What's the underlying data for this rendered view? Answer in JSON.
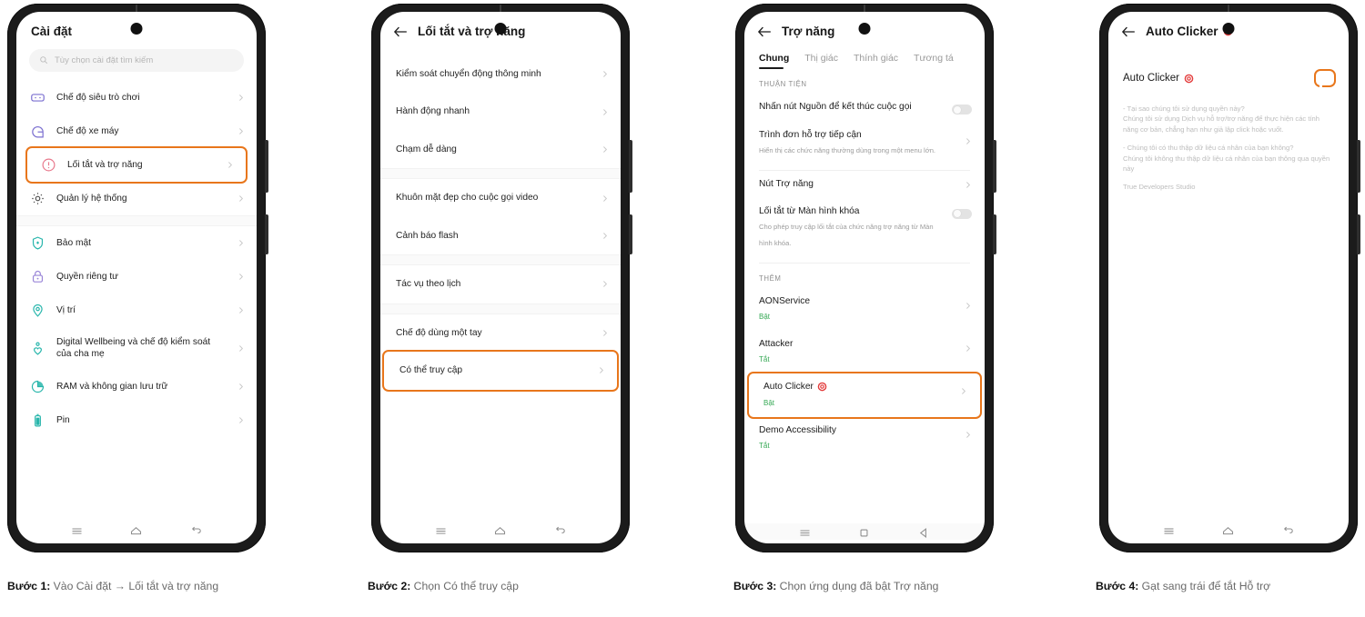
{
  "phones": [
    {
      "id": "settings",
      "header_title": "Cài đặt",
      "search_placeholder": "Tùy chọn cài đặt tìm kiếm",
      "items": [
        {
          "label": "Chế độ siêu trò chơi",
          "icon": "game-controller-icon",
          "highlight": false
        },
        {
          "label": "Chế độ xe máy",
          "icon": "helmet-icon",
          "highlight": false
        },
        {
          "label": "Lối tắt và trợ năng",
          "icon": "accessibility-icon",
          "highlight": true
        },
        {
          "label": "Quản lý hệ thống",
          "icon": "gear-icon",
          "highlight": false
        },
        {
          "label": "Bảo mật",
          "icon": "shield-icon",
          "highlight": false
        },
        {
          "label": "Quyền riêng tư",
          "icon": "lock-icon",
          "highlight": false
        },
        {
          "label": "Vị trí",
          "icon": "location-pin-icon",
          "highlight": false
        },
        {
          "label": "Digital Wellbeing và chế độ kiểm soát của cha mẹ",
          "icon": "wellbeing-icon",
          "highlight": false
        },
        {
          "label": "RAM và không gian lưu trữ",
          "icon": "storage-pie-icon",
          "highlight": false
        },
        {
          "label": "Pin",
          "icon": "battery-icon",
          "highlight": false
        }
      ],
      "navbar": [
        "menu-icon",
        "home-icon",
        "back-icon"
      ]
    },
    {
      "id": "shortcuts",
      "header_title": "Lối tắt và trợ năng",
      "items": [
        {
          "label": "Kiểm soát chuyển động thông minh",
          "highlight": false
        },
        {
          "label": "Hành động nhanh",
          "highlight": false
        },
        {
          "label": "Chạm dễ dàng",
          "highlight": false
        },
        {
          "label": "Khuôn mặt đẹp cho cuộc gọi video",
          "highlight": false
        },
        {
          "label": "Cảnh báo flash",
          "highlight": false
        },
        {
          "label": "Tác vụ theo lịch",
          "highlight": false
        },
        {
          "label": "Chế độ dùng một tay",
          "highlight": false
        },
        {
          "label": "Có thể truy cập",
          "highlight": true
        }
      ],
      "navbar": [
        "menu-icon",
        "home-icon",
        "back-icon"
      ]
    },
    {
      "id": "accessibility",
      "header_title": "Trợ năng",
      "tabs": [
        {
          "label": "Chung",
          "active": true
        },
        {
          "label": "Thị giác",
          "active": false
        },
        {
          "label": "Thính giác",
          "active": false
        },
        {
          "label": "Tương tá",
          "active": false
        }
      ],
      "section1_header": "THUẬN TIỆN",
      "section1_items": [
        {
          "title": "Nhấn nút Nguồn để kết thúc cuộc gọi",
          "subtitle": "",
          "control": "toggle-off"
        },
        {
          "title": "Trình đơn hỗ trợ tiếp cận",
          "subtitle": "Hiển thị các chức năng thường dùng trong một menu lớn.",
          "control": "chevron"
        },
        {
          "title": "Nút Trợ năng",
          "subtitle": "",
          "control": "chevron"
        },
        {
          "title": "Lối tắt từ Màn hình khóa",
          "subtitle": "Cho phép truy cập lối tắt của chức năng trợ năng từ Màn hình khóa.",
          "control": "toggle-off"
        }
      ],
      "section2_header": "THÊM",
      "section2_items": [
        {
          "title": "AONService",
          "status": "Bật",
          "highlight": false,
          "target_icon": false
        },
        {
          "title": "Attacker",
          "status": "Tắt",
          "highlight": false,
          "target_icon": false
        },
        {
          "title": "Auto Clicker",
          "status": "Bật",
          "highlight": true,
          "target_icon": true
        },
        {
          "title": "Demo Accessibility",
          "status": "Tắt",
          "highlight": false,
          "target_icon": false
        }
      ],
      "navbar": [
        "menu-icon",
        "square-home-icon",
        "triangle-back-icon"
      ]
    },
    {
      "id": "autoclicker",
      "header_title": "Auto Clicker",
      "item_title": "Auto Clicker",
      "toggle_state": "on",
      "body_paragraphs": [
        "- Tại sao chúng tôi sử dụng quyền này?\nChúng tôi sử dụng Dịch vụ hỗ trợ/trợ năng để thực hiện các tính năng cơ bản, chẳng hạn như giả lập click hoặc vuốt.",
        "- Chúng tôi có thu thập dữ liệu cá nhân của bạn không?\nChúng tôi không thu thập dữ liệu cá nhân của bạn thông qua quyền này",
        "True Developers Studio"
      ],
      "navbar": [
        "menu-icon",
        "home-icon",
        "back-icon"
      ]
    }
  ],
  "captions": [
    {
      "step": "Bước 1:",
      "text": " Vào Cài đặt → Lối tắt và trợ năng"
    },
    {
      "step": "Bước 2:",
      "text": " Chọn Có thể truy cập"
    },
    {
      "step": "Bước 3:",
      "text": " Chọn ứng dụng đã bật Trợ năng"
    },
    {
      "step": "Bước 4:",
      "text": " Gạt sang trái để tắt Hỗ trợ"
    }
  ],
  "colors": {
    "highlight": "#e8761b",
    "toggle_on": "#2a6ce0",
    "status_on": "#34a853",
    "frame": "#1b1b1b"
  }
}
